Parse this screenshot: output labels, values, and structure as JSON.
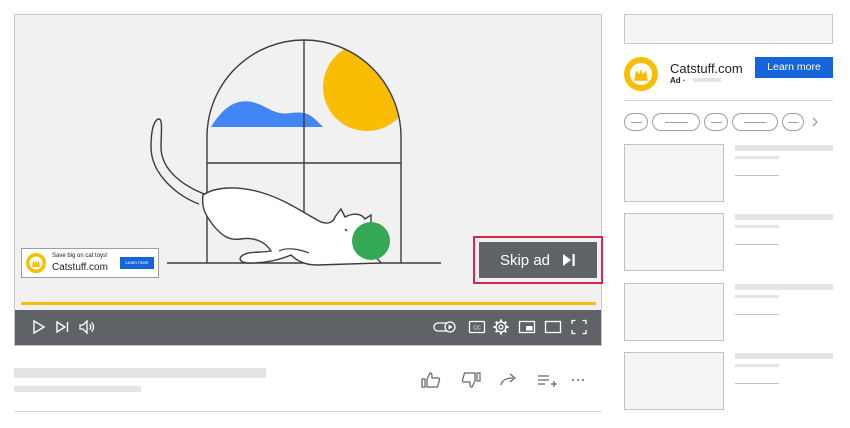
{
  "player": {
    "inline_ad": {
      "message": "Save big on cat toys!",
      "site": "Catstuff.com",
      "button_label": "Learn more"
    },
    "skip_button_label": "Skip ad",
    "progress": 1.0,
    "controls_left": [
      "play-icon",
      "next-icon",
      "volume-icon"
    ],
    "controls_right": [
      "autoplay-toggle-icon",
      "closed-captions-icon",
      "settings-gear-icon",
      "miniplayer-icon",
      "theater-mode-icon",
      "fullscreen-icon"
    ]
  },
  "sidebar": {
    "ad": {
      "site": "Catstuff.com",
      "label": "Ad ·",
      "button_label": "Learn more"
    }
  },
  "colors": {
    "skip_highlight": "#dc2650",
    "accent_blue": "#1565d8",
    "progress_yellow": "#fbbc04",
    "controls_gray": "#5f6368",
    "sun_yellow": "#fbbc04",
    "ball_green": "#34a853",
    "cloud_blue": "#4285f4"
  }
}
